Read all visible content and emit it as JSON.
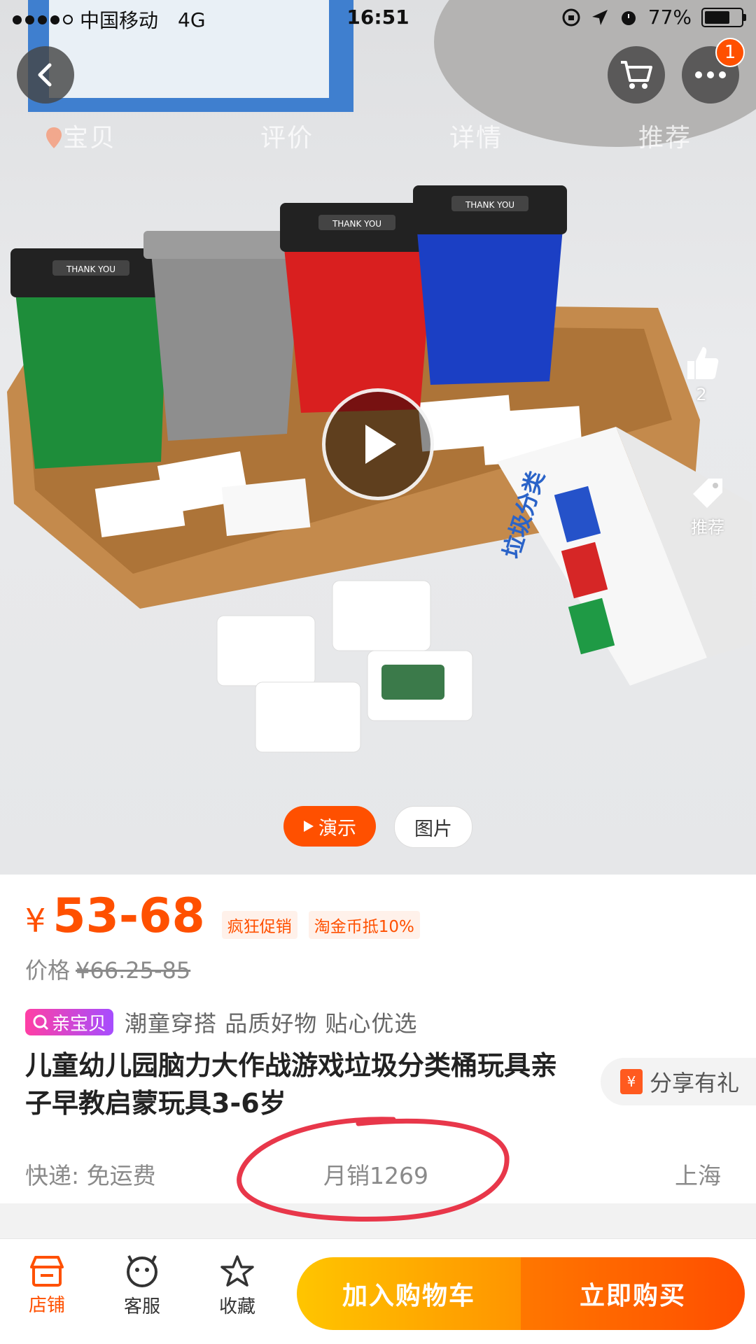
{
  "status_bar": {
    "carrier": "中国移动",
    "network": "4G",
    "time": "16:51",
    "battery": "77%",
    "battery_level": 0.77
  },
  "header": {
    "cart_badge": "1",
    "anchor_tabs": [
      "宝贝",
      "评价",
      "详情",
      "推荐"
    ]
  },
  "media": {
    "like_count": "2",
    "recommend_label": "推荐",
    "tabs": {
      "video": "演示",
      "image": "图片"
    },
    "product_print": {
      "book_title": "垃圾分类",
      "bin_lid_text": "THANK YOU"
    }
  },
  "price": {
    "currency": "¥",
    "range": "53-68",
    "promo_1": "疯狂促销",
    "promo_2": "淘金币抵10%",
    "original_label": "价格",
    "original_price": "¥66.25-85"
  },
  "product": {
    "badge": "亲宝贝",
    "subtitle": "潮童穿搭 品质好物 贴心优选",
    "title": "儿童幼儿园脑力大作战游戏垃圾分类桶玩具亲子早教启蒙玩具3-6岁",
    "share": "分享有礼",
    "share_icon": "¥"
  },
  "meta": {
    "shipping": "快递: 免运费",
    "monthly_sales": "月销1269",
    "location": "上海"
  },
  "bottom_bar": {
    "store": "店铺",
    "service": "客服",
    "favorite": "收藏",
    "add_to_cart": "加入购物车",
    "buy_now": "立即购买"
  },
  "colors": {
    "accent": "#ff5000",
    "cart_button": "#ff9f00",
    "highlight_ring": "#e8374a"
  }
}
